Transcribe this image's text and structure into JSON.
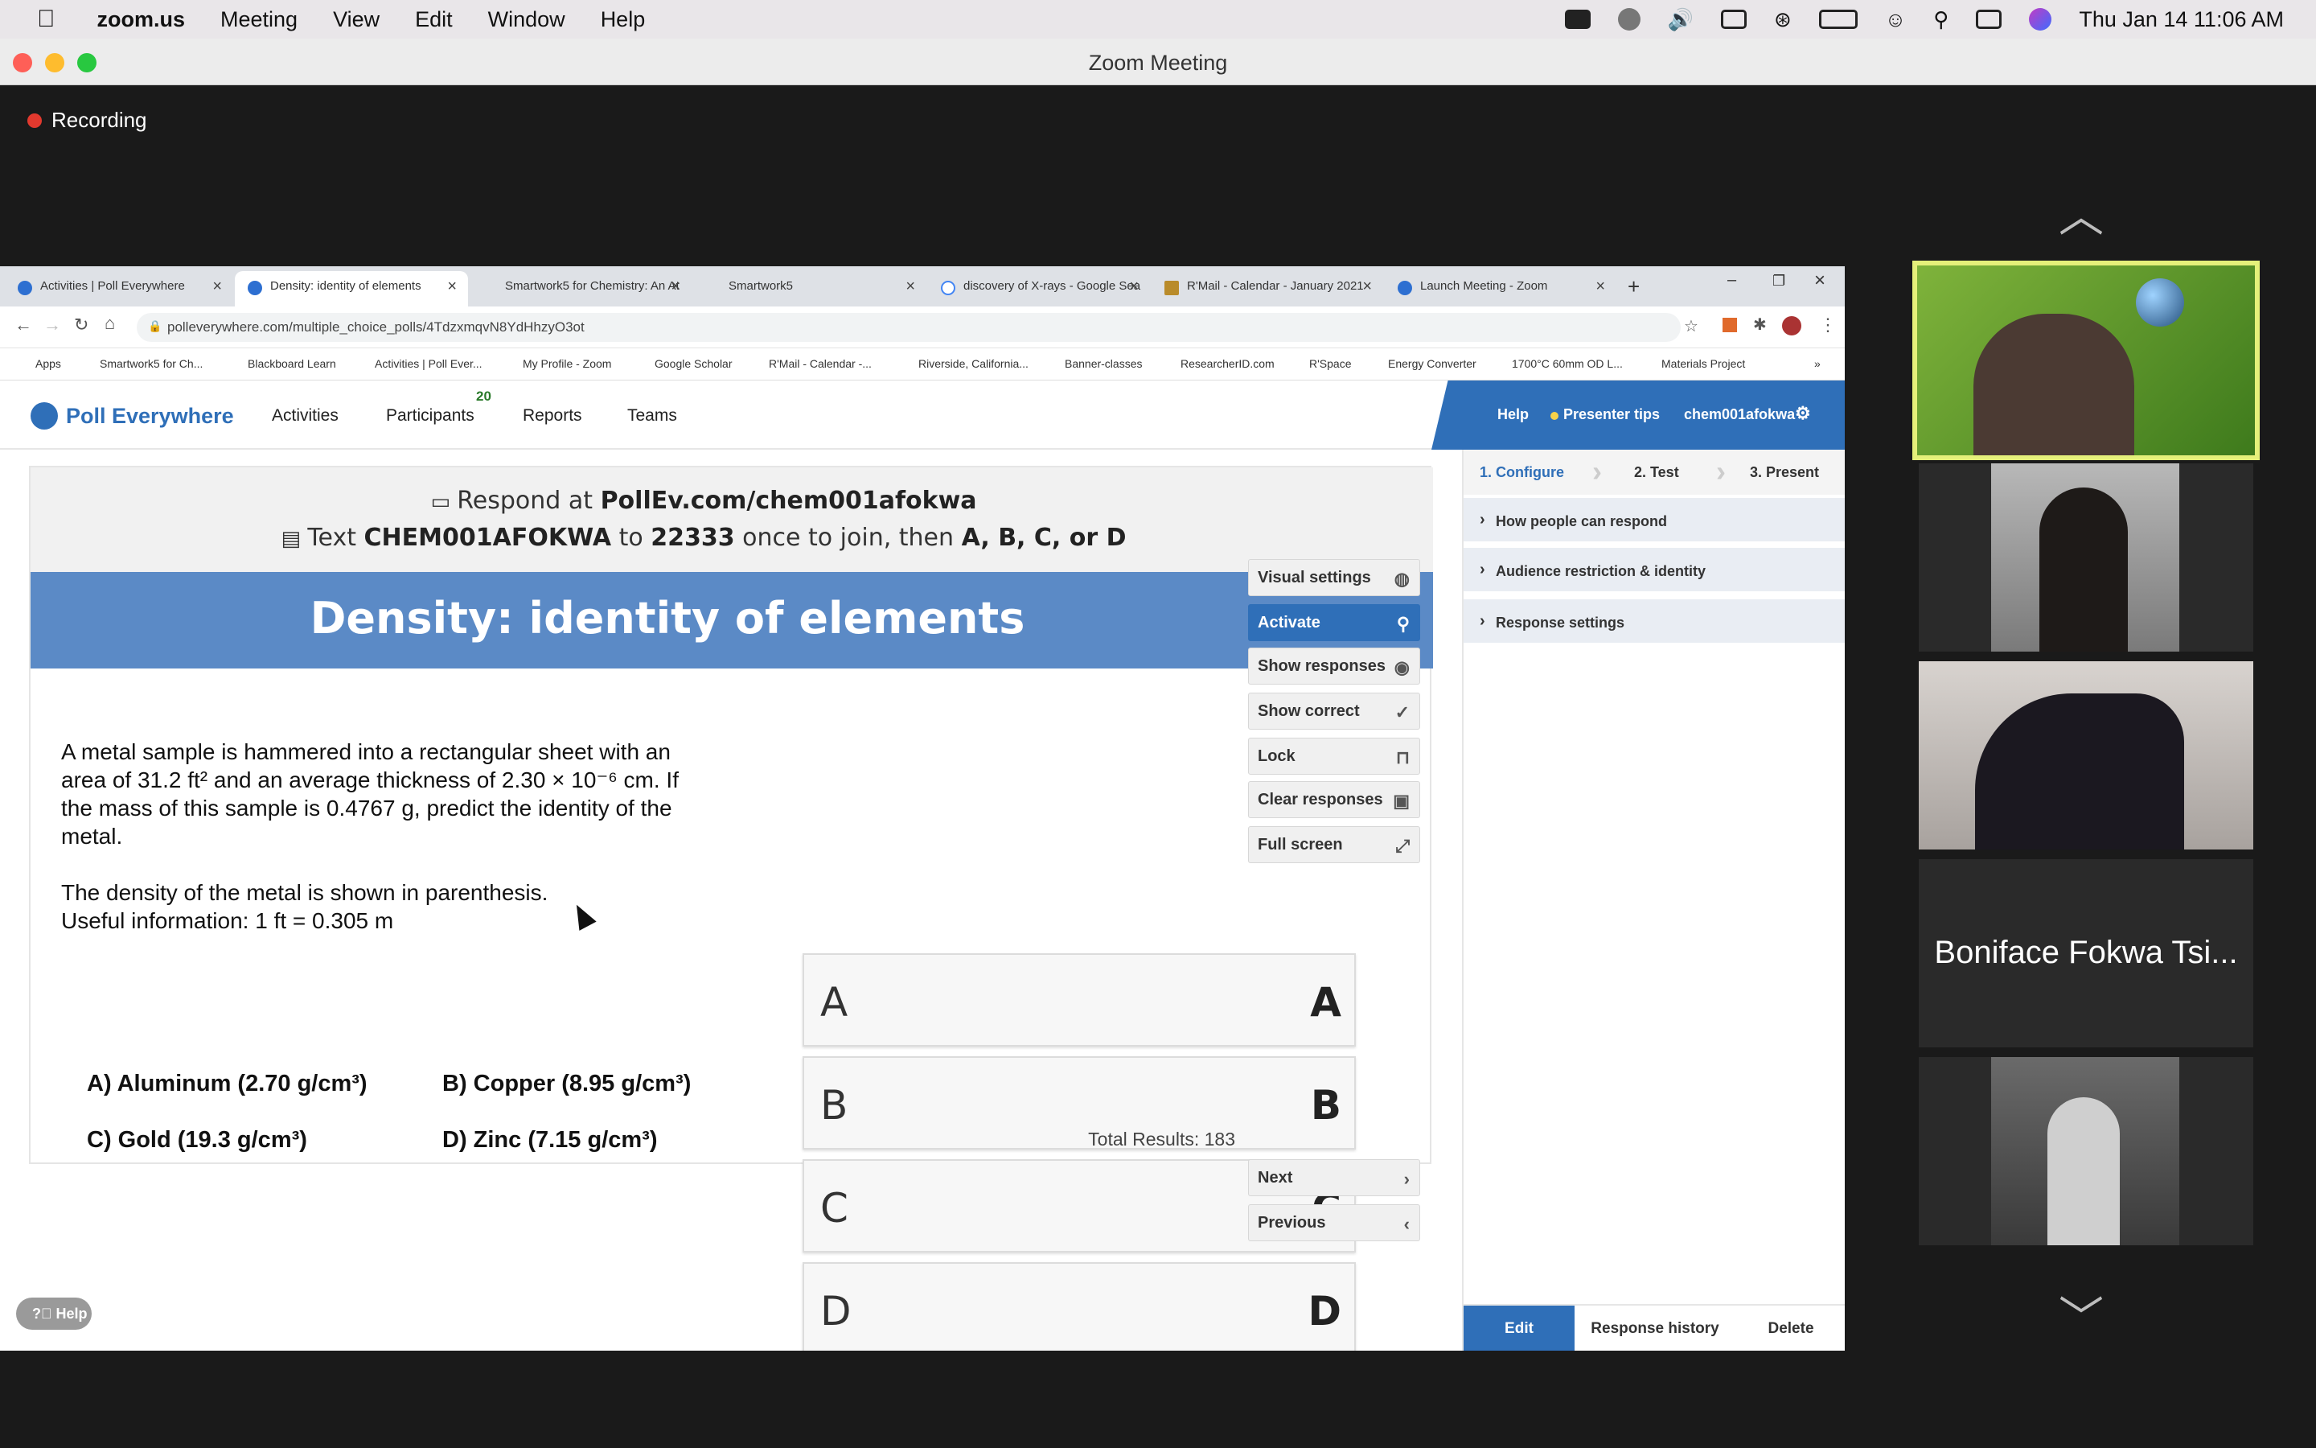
{
  "menubar": {
    "app": "zoom.us",
    "items": [
      "Meeting",
      "View",
      "Edit",
      "Window",
      "Help"
    ],
    "clock": "Thu Jan 14  11:06 AM"
  },
  "window": {
    "title": "Zoom Meeting"
  },
  "recording": {
    "label": "Recording"
  },
  "browser": {
    "tabs": [
      {
        "label": "Activities | Poll Everywhere"
      },
      {
        "label": "Density: identity of elements"
      },
      {
        "label": "Smartwork5 for Chemistry: An At"
      },
      {
        "label": "Smartwork5"
      },
      {
        "label": "discovery of X-rays - Google Sea"
      },
      {
        "label": "R'Mail - Calendar - January 2021"
      },
      {
        "label": "Launch Meeting - Zoom"
      }
    ],
    "url": "pollev​erywhere.com/multiple_choice_polls/4TdzxmqvN8YdHhzyO3ot",
    "bookmarks": [
      "Apps",
      "Smartwork5 for Ch...",
      "Blackboard Learn",
      "Activities | Poll Ever...",
      "My Profile - Zoom",
      "Google Scholar",
      "R'Mail - Calendar -...",
      "Riverside, California...",
      "Banner-classes",
      "ResearcherID.com",
      "R'Space",
      "Energy Converter",
      "1700°C 60mm OD L...",
      "Materials Project"
    ]
  },
  "pe": {
    "logo": "Poll Everywhere",
    "nav": {
      "activities": "Activities",
      "participants": "Participants",
      "participants_count": "20",
      "reports": "Reports",
      "teams": "Teams"
    },
    "help": "Help",
    "presenter_tips": "Presenter tips",
    "user": "chem001afokwa"
  },
  "slide": {
    "respond_prefix": "Respond at ",
    "respond_url": "PollEv.com/chem001afokwa",
    "text_prefix": "Text ",
    "text_code": "CHEM001AFOKWA",
    "text_mid": " to ",
    "text_number": "22333",
    "text_suffix": " once to join, then ",
    "text_choices": "A, B, C, or D",
    "title": "Density: identity of elements",
    "question_p1": "A metal sample is hammered into a rectangular sheet with an area of 31.2 ft² and an average thickness of 2.30 × 10⁻⁶ cm. If the mass of this sample is 0.4767 g, predict the identity of the metal.",
    "question_p2a": "The density of the metal is shown in parenthesis.",
    "question_p2b": "Useful information: 1 ft = 0.305 m",
    "choices": {
      "a": "A) Aluminum (2.70 g/cm³)",
      "b": "B) Copper (8.95 g/cm³)",
      "c": "C) Gold (19.3 g/cm³)",
      "d": "D) Zinc (7.15 g/cm³)"
    },
    "options": [
      "A",
      "B",
      "C",
      "D"
    ],
    "total": "Total Results: 183"
  },
  "controls": {
    "visual_settings": "Visual settings",
    "activate": "Activate",
    "show_responses": "Show responses",
    "show_correct": "Show correct",
    "lock": "Lock",
    "clear_responses": "Clear responses",
    "full_screen": "Full screen",
    "next": "Next",
    "previous": "Previous"
  },
  "config": {
    "step1": "1. Configure",
    "step2": "2. Test",
    "step3": "3. Present",
    "acc1": "How people can respond",
    "acc2": "Audience restriction & identity",
    "acc3": "Response settings",
    "edit": "Edit",
    "history": "Response history",
    "delete": "Delete"
  },
  "help_widget": "Help",
  "participants": {
    "name_tile": "Boniface Fokwa Tsi..."
  }
}
